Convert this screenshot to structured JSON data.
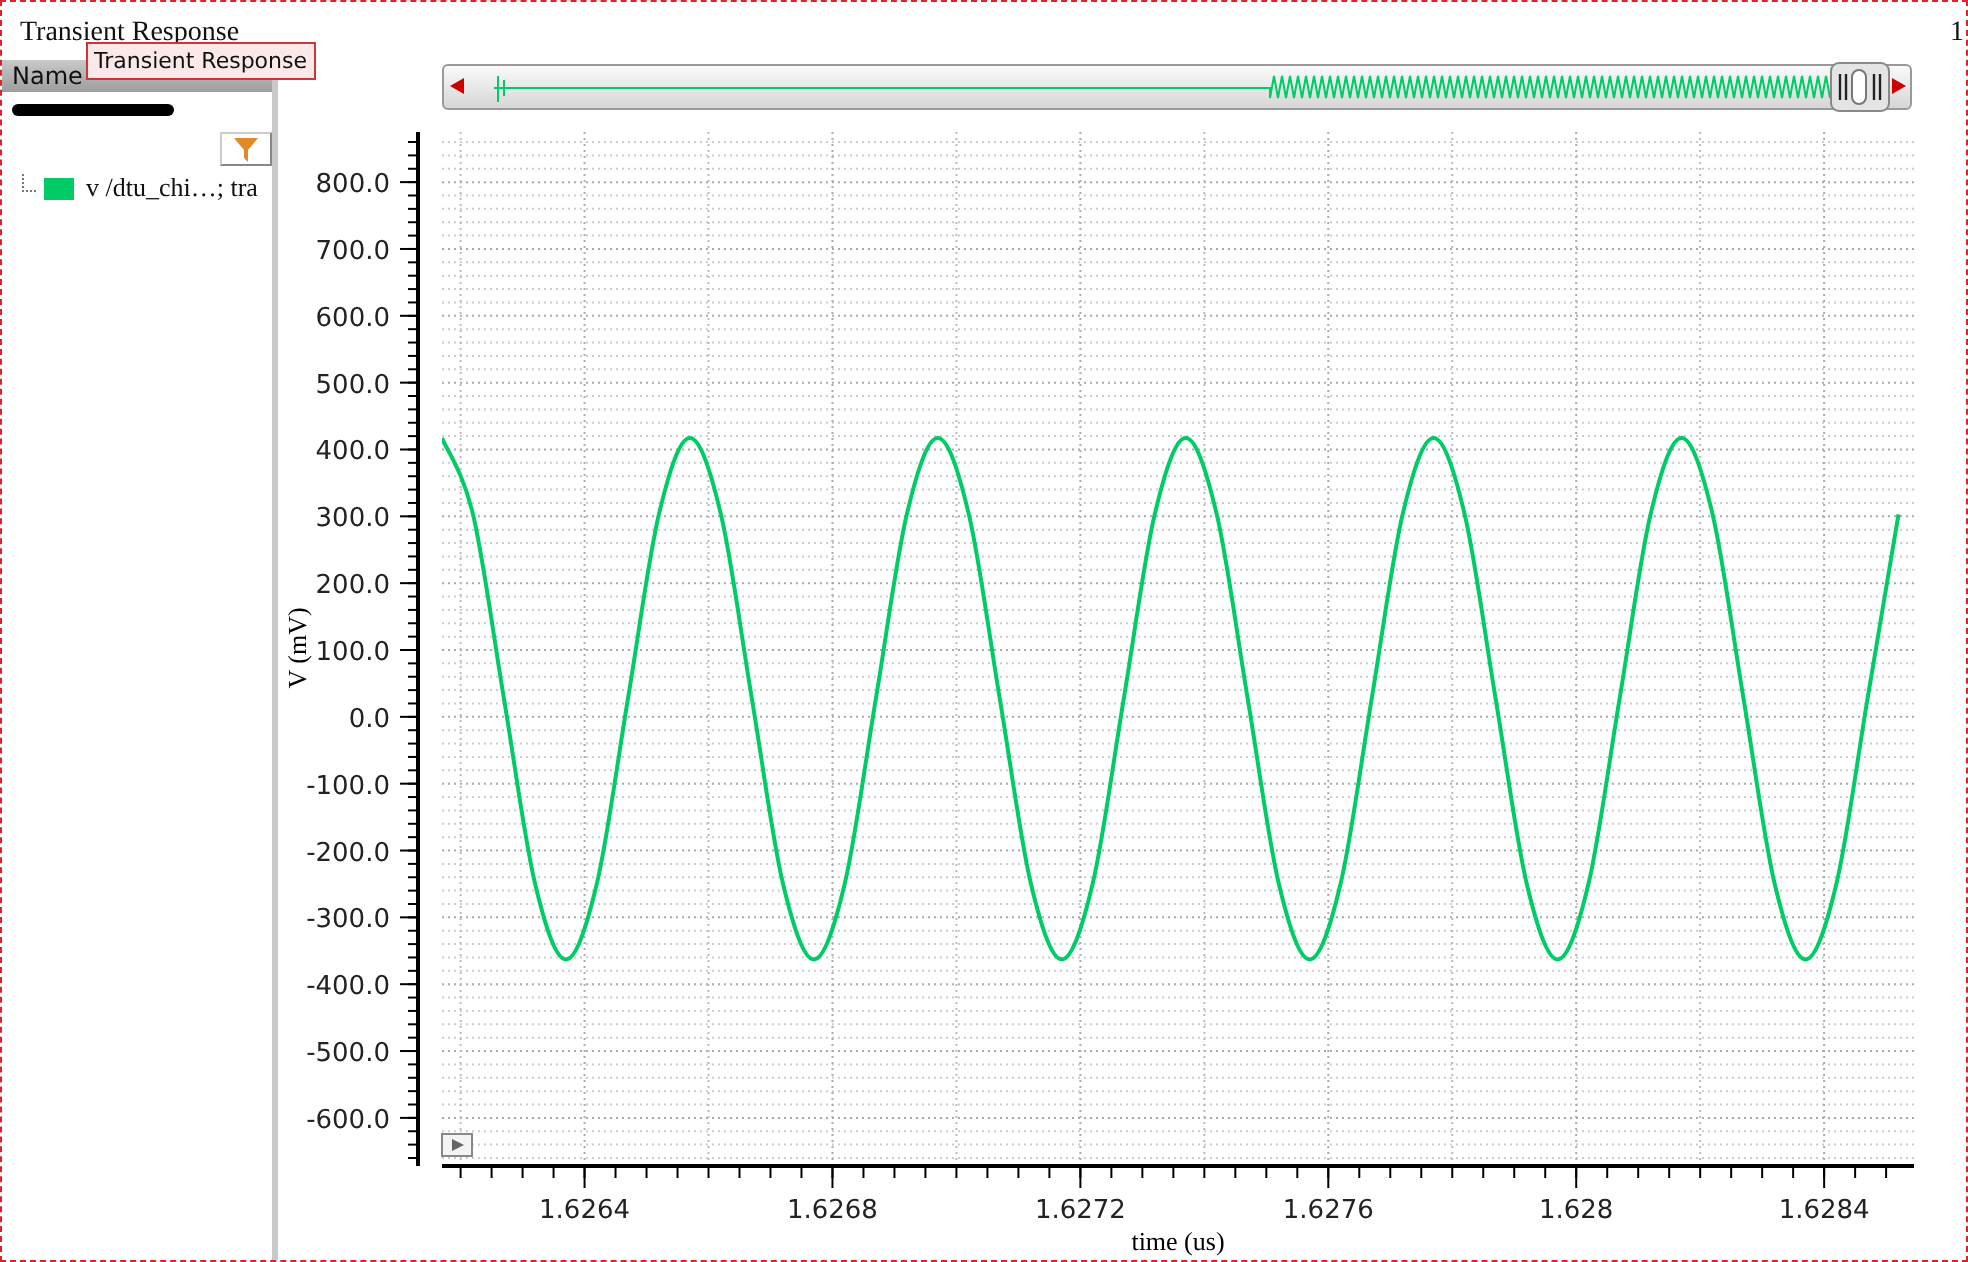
{
  "window": {
    "title": "Transient Response",
    "corner_text": "1"
  },
  "tooltip": "Transient Response",
  "panel": {
    "header": "Name",
    "items": [
      {
        "label": "v /dtu_chi…; tra",
        "color": "#00cc66"
      }
    ]
  },
  "chart": {
    "chart_data": {
      "type": "line",
      "xlabel": "time (us)",
      "ylabel": "V (mV)",
      "grid": true,
      "xlim": [
        1.62617,
        1.628545
      ],
      "ylim": [
        -672,
        875
      ],
      "xticks": [
        {
          "value": 1.6264,
          "label": "1.6264"
        },
        {
          "value": 1.6268,
          "label": "1.6268"
        },
        {
          "value": 1.6272,
          "label": "1.6272"
        },
        {
          "value": 1.6276,
          "label": "1.6276"
        },
        {
          "value": 1.628,
          "label": "1.628"
        },
        {
          "value": 1.6284,
          "label": "1.6284"
        }
      ],
      "yticks": [
        {
          "value": 800,
          "label": "800.0"
        },
        {
          "value": 700,
          "label": "700.0"
        },
        {
          "value": 600,
          "label": "600.0"
        },
        {
          "value": 500,
          "label": "500.0"
        },
        {
          "value": 400,
          "label": "400.0"
        },
        {
          "value": 300,
          "label": "300.0"
        },
        {
          "value": 200,
          "label": "200.0"
        },
        {
          "value": 100,
          "label": "100.0"
        },
        {
          "value": 0,
          "label": "0.0"
        },
        {
          "value": -100,
          "label": "-100.0"
        },
        {
          "value": -200,
          "label": "-200.0"
        },
        {
          "value": -300,
          "label": "-300.0"
        },
        {
          "value": -400,
          "label": "-400.0"
        },
        {
          "value": -500,
          "label": "-500.0"
        },
        {
          "value": -600,
          "label": "-600.0"
        }
      ],
      "x": [
        1.62617,
        1.62622,
        1.62627,
        1.62632,
        1.62637,
        1.62642,
        1.62647,
        1.62652,
        1.62657,
        1.62662,
        1.62667,
        1.62672,
        1.62677,
        1.62682,
        1.62687,
        1.62692,
        1.62697,
        1.62702,
        1.62707,
        1.62712,
        1.62717,
        1.62722,
        1.62727,
        1.62732,
        1.62737,
        1.62742,
        1.62747,
        1.62752,
        1.62757,
        1.62762,
        1.62767,
        1.62772,
        1.62777,
        1.62782,
        1.62787,
        1.62792,
        1.62797,
        1.62802,
        1.62807,
        1.62812,
        1.62817,
        1.62822,
        1.62827,
        1.62832,
        1.62837,
        1.62842,
        1.62847,
        1.62852
      ],
      "series": [
        {
          "color": "#00cc66",
          "values": [
            417,
            303,
            27,
            -249,
            -363,
            -249,
            27,
            303,
            417,
            303,
            27,
            -249,
            -363,
            -249,
            27,
            303,
            417,
            303,
            27,
            -249,
            -363,
            -249,
            27,
            303,
            417,
            303,
            27,
            -249,
            -363,
            -249,
            27,
            303,
            417,
            303,
            27,
            -249,
            -363,
            -249,
            27,
            303,
            417,
            303,
            27,
            -249,
            -363,
            -249,
            27,
            303
          ]
        }
      ]
    }
  }
}
